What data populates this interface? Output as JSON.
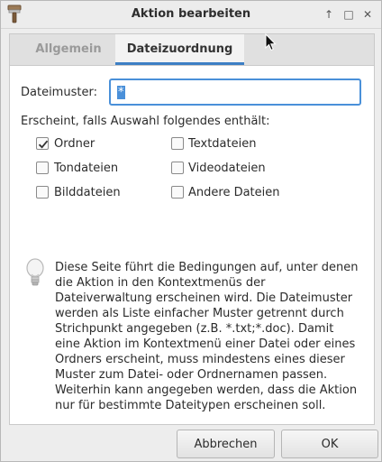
{
  "window": {
    "title": "Aktion bearbeiten",
    "controls": {
      "up": "↑",
      "restore": "□",
      "close": "✕"
    }
  },
  "tabs": [
    {
      "label": "Allgemein",
      "active": false
    },
    {
      "label": "Dateizuordnung",
      "active": true
    }
  ],
  "file_pattern": {
    "label": "Dateimuster:",
    "value": "*"
  },
  "appears_if": {
    "label": "Erscheint, falls Auswahl folgendes enthält:",
    "options": [
      {
        "label": "Ordner",
        "checked": true
      },
      {
        "label": "Textdateien",
        "checked": false
      },
      {
        "label": "Tondateien",
        "checked": false
      },
      {
        "label": "Videodateien",
        "checked": false
      },
      {
        "label": "Bilddateien",
        "checked": false
      },
      {
        "label": "Andere Dateien",
        "checked": false
      }
    ]
  },
  "info": {
    "icon": "lightbulb-icon",
    "text": "Diese Seite führt die Bedingungen auf, unter denen\ndie Aktion in den Kontextmenüs der\nDateiverwaltung erscheinen wird. Die Dateimuster\nwerden als Liste einfacher Muster getrennt durch\nStrichpunkt angegeben (z.B. *.txt;*.doc). Damit\neine Aktion im Kontextmenü einer Datei oder eines\nOrdners erscheint, muss mindestens eines dieser\nMuster zum Datei- oder Ordnernamen passen.\nWeiterhin kann angegeben werden, dass die Aktion\nnur für bestimmte Dateitypen erscheinen soll."
  },
  "buttons": {
    "cancel": "Abbrechen",
    "ok": "OK"
  },
  "colors": {
    "accent": "#4a90d9",
    "tab_underline": "#3d7fc4"
  }
}
